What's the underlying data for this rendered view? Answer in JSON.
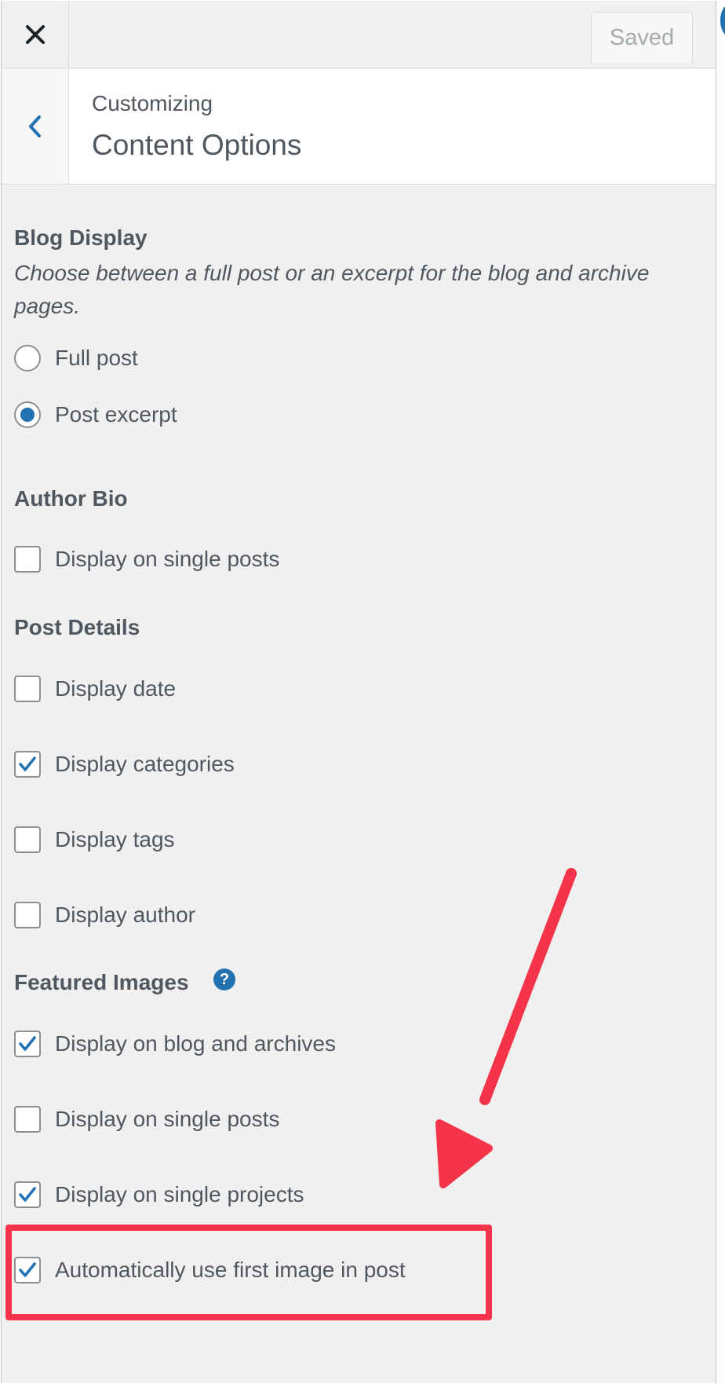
{
  "topbar": {
    "close_icon": "close-icon",
    "saved_label": "Saved"
  },
  "header": {
    "back_icon": "chevron-left-icon",
    "breadcrumb": "Customizing",
    "title": "Content Options"
  },
  "blog_display": {
    "title": "Blog Display",
    "description": "Choose between a full post or an excerpt for the blog and archive pages.",
    "options": [
      {
        "label": "Full post",
        "selected": false
      },
      {
        "label": "Post excerpt",
        "selected": true
      }
    ]
  },
  "author_bio": {
    "title": "Author Bio",
    "options": [
      {
        "label": "Display on single posts",
        "checked": false
      }
    ]
  },
  "post_details": {
    "title": "Post Details",
    "options": [
      {
        "label": "Display date",
        "checked": false
      },
      {
        "label": "Display categories",
        "checked": true
      },
      {
        "label": "Display tags",
        "checked": false
      },
      {
        "label": "Display author",
        "checked": false
      }
    ]
  },
  "featured_images": {
    "title": "Featured Images",
    "help_icon": "question-mark-icon",
    "help_glyph": "?",
    "options": [
      {
        "label": "Display on blog and archives",
        "checked": true
      },
      {
        "label": "Display on single posts",
        "checked": false
      },
      {
        "label": "Display on single projects",
        "checked": true
      },
      {
        "label": "Automatically use first image in post",
        "checked": true
      }
    ]
  },
  "colors": {
    "accent": "#2271b1",
    "annotation": "#f53449"
  }
}
